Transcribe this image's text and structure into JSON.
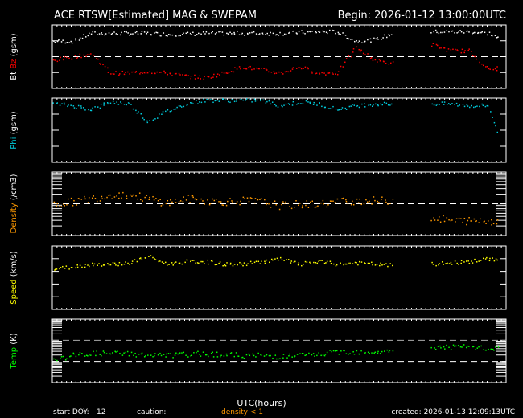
{
  "header": {
    "title": "ACE RTSW[Estimated] MAG & SWEPAM",
    "begin": "Begin: 2026-01-12 13:00:00UTC"
  },
  "footer": {
    "start_doy_label": "start DOY:",
    "start_doy": "12",
    "caution_label": "caution:",
    "caution_text": "density < 1",
    "created": "created: 2026-01-13 12:09:13UTC"
  },
  "colors": {
    "bt": "#ffffff",
    "bz": "#ff0000",
    "phi": "#00ccdd",
    "density": "#ff9900",
    "speed": "#ffff00",
    "temp": "#00ff00",
    "caution": "#ff9900"
  },
  "chart_data": [
    {
      "type": "scatter",
      "ylabel_parts": [
        "Bt",
        "Bz",
        "(gsm)"
      ],
      "ylim": [
        -10,
        10
      ],
      "ticks": [
        "10",
        "5",
        "0",
        "-5",
        "-10"
      ],
      "reference_line": 0,
      "x_start_hour_utc": 13,
      "series": [
        {
          "name": "Bt",
          "values": [
            5,
            5,
            7.5,
            7.5,
            7.5,
            7.5,
            7.2,
            7.3,
            7.5,
            7.5,
            7.5,
            7.5,
            7.5,
            7.8,
            8,
            8,
            5,
            5.5,
            7.5,
            null,
            8,
            8,
            8,
            7.5,
            4.5
          ]
        },
        {
          "name": "Bz",
          "values": [
            -1,
            0,
            1,
            -5,
            -5,
            -4.5,
            -5,
            -6,
            -6.5,
            -5,
            -3,
            -4,
            -5,
            -3,
            -5,
            -5,
            3,
            -1,
            -2,
            null,
            4,
            2,
            2,
            -4,
            -3
          ]
        }
      ]
    },
    {
      "type": "scatter",
      "ylabel_parts": [
        "Phi",
        "(gsm)"
      ],
      "ylim": [
        0,
        360
      ],
      "ticks": [
        "360",
        "270",
        "180",
        "90",
        "0"
      ],
      "series": [
        {
          "name": "Phi",
          "values": [
            330,
            320,
            300,
            340,
            330,
            230,
            290,
            330,
            350,
            350,
            350,
            350,
            320,
            340,
            330,
            300,
            320,
            330,
            330,
            null,
            330,
            330,
            320,
            320,
            20
          ]
        }
      ]
    },
    {
      "type": "scatter",
      "scale": "log",
      "ylabel_parts": [
        "Density",
        "(/cm3)"
      ],
      "ylim": [
        0.1,
        10
      ],
      "ticks": [
        "10.0",
        "1.0",
        "0.1"
      ],
      "reference_line": 1,
      "series": [
        {
          "name": "Density",
          "values": [
            1.0,
            1.2,
            1.5,
            2,
            2,
            1.5,
            1.1,
            1.5,
            1.3,
            1.2,
            1.3,
            1.2,
            0.9,
            1.0,
            1.0,
            1.2,
            1.3,
            1.3,
            1.3,
            null,
            0.4,
            0.3,
            0.3,
            0.3,
            0.3
          ]
        }
      ]
    },
    {
      "type": "scatter",
      "ylabel_parts": [
        "Speed",
        "(km/s)"
      ],
      "ylim": [
        200,
        700
      ],
      "ticks": [
        "700",
        "600",
        "500",
        "400",
        "300",
        "200"
      ],
      "series": [
        {
          "name": "Speed",
          "values": [
            520,
            540,
            560,
            560,
            570,
            620,
            560,
            580,
            580,
            560,
            560,
            580,
            600,
            560,
            580,
            560,
            570,
            560,
            550,
            null,
            560,
            570,
            580,
            600,
            600
          ]
        }
      ]
    },
    {
      "type": "scatter",
      "scale": "log",
      "ylabel_parts": [
        "Temp",
        "(K)"
      ],
      "ylim": [
        10000,
        10000000
      ],
      "ticks": [
        "1.0E+07",
        "1.0E+06",
        "1.0E+05",
        "1.0E+04"
      ],
      "reference_lines": [
        100000,
        1000000
      ],
      "series": [
        {
          "name": "Temp",
          "values": [
            120000,
            200000,
            250000,
            250000,
            250000,
            200000,
            200000,
            220000,
            250000,
            220000,
            200000,
            200000,
            180000,
            200000,
            220000,
            300000,
            300000,
            300000,
            300000,
            null,
            500000,
            500000,
            500000,
            400000,
            400000
          ]
        }
      ]
    }
  ],
  "xaxis": {
    "label": "UTC(hours)",
    "ticks": [
      "13",
      "15",
      "17",
      "19",
      "21",
      "23",
      "01",
      "03",
      "05",
      "07",
      "09",
      "11",
      "13"
    ]
  }
}
